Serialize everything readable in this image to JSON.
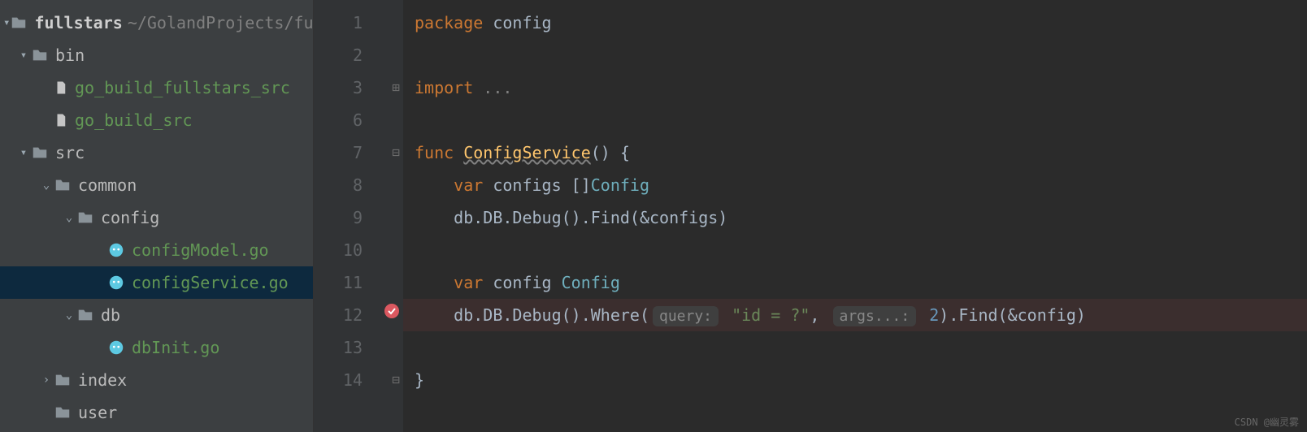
{
  "sidebar": {
    "root": {
      "name": "fullstars",
      "path": "~/GolandProjects/ful"
    },
    "items": [
      {
        "label": "bin"
      },
      {
        "label": "go_build_fullstars_src"
      },
      {
        "label": "go_build_src"
      },
      {
        "label": "src"
      },
      {
        "label": "common"
      },
      {
        "label": "config"
      },
      {
        "label": "configModel.go"
      },
      {
        "label": "configService.go"
      },
      {
        "label": "db"
      },
      {
        "label": "dbInit.go"
      },
      {
        "label": "index"
      },
      {
        "label": "user"
      }
    ]
  },
  "gutter": {
    "lines": [
      "1",
      "2",
      "3",
      "6",
      "7",
      "8",
      "9",
      "10",
      "11",
      "12",
      "13",
      "14"
    ]
  },
  "code": {
    "l1": {
      "kw": "package",
      "id": " config"
    },
    "l3": {
      "kw": "import",
      "ell": " ..."
    },
    "l7": {
      "kw": "func",
      "fn": "ConfigService",
      "rest": "() {"
    },
    "l8": {
      "kw": "var",
      "id": " configs []",
      "ty": "Config"
    },
    "l9": {
      "txt": "db.DB.Debug().Find(&configs)"
    },
    "l11": {
      "kw": "var",
      "id": " config ",
      "ty": "Config"
    },
    "l12": {
      "p1": "db.DB.Debug().Where(",
      "h1": "query:",
      "str": " \"id = ?\"",
      "comma": ", ",
      "h2": "args...:",
      "num": " 2",
      "p2": ").Find(&config)"
    },
    "l14": {
      "brace": "}"
    }
  },
  "watermark": "CSDN @幽灵雾"
}
